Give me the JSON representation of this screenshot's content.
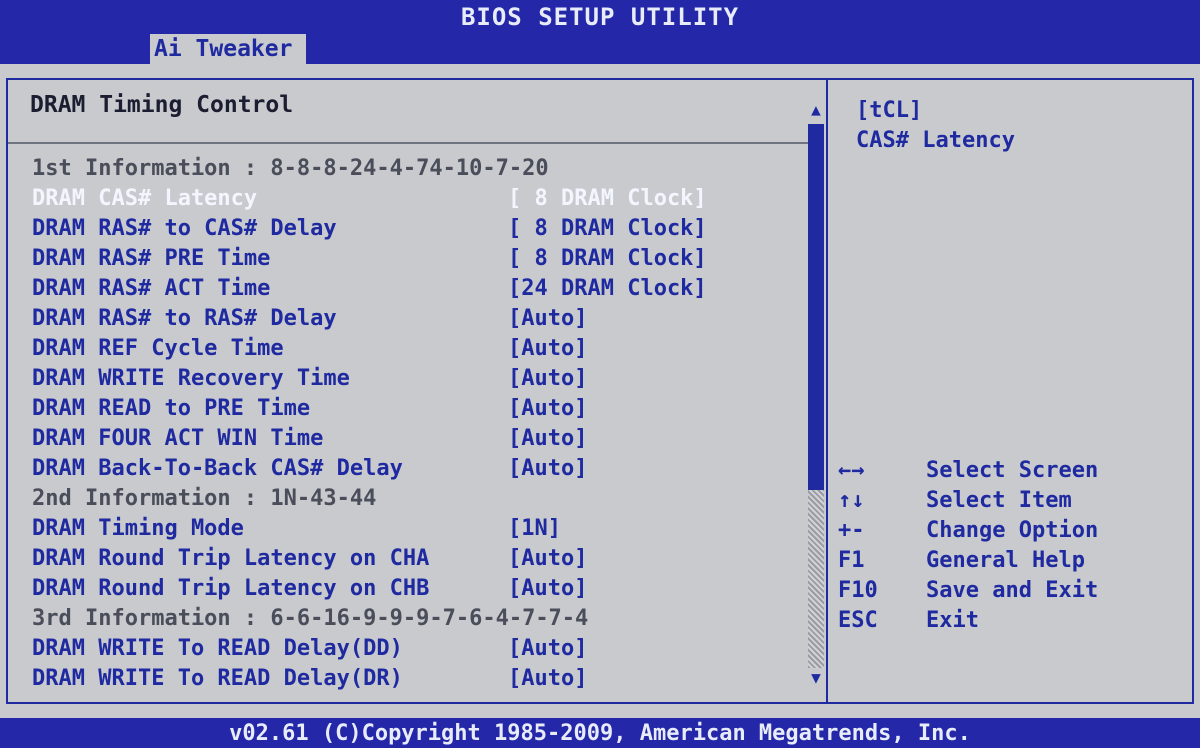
{
  "window": {
    "title": "BIOS SETUP UTILITY"
  },
  "tabs": [
    {
      "label": "Ai Tweaker",
      "active": true
    }
  ],
  "section": {
    "title": "DRAM Timing Control"
  },
  "items": [
    {
      "label": "1st Information : 8-8-8-24-4-74-10-7-20",
      "value": "",
      "type": "info"
    },
    {
      "label": "DRAM CAS# Latency",
      "value": "[ 8 DRAM Clock]",
      "type": "selected"
    },
    {
      "label": "DRAM RAS# to CAS# Delay",
      "value": "[ 8 DRAM Clock]",
      "type": "option"
    },
    {
      "label": "DRAM RAS# PRE Time",
      "value": "[ 8 DRAM Clock]",
      "type": "option"
    },
    {
      "label": "DRAM RAS# ACT Time",
      "value": "[24 DRAM Clock]",
      "type": "option"
    },
    {
      "label": "DRAM RAS# to RAS# Delay",
      "value": "[Auto]",
      "type": "option"
    },
    {
      "label": "DRAM REF Cycle Time",
      "value": "[Auto]",
      "type": "option"
    },
    {
      "label": "DRAM WRITE Recovery Time",
      "value": "[Auto]",
      "type": "option"
    },
    {
      "label": "DRAM READ to PRE Time",
      "value": "[Auto]",
      "type": "option"
    },
    {
      "label": "DRAM FOUR ACT WIN Time",
      "value": "[Auto]",
      "type": "option"
    },
    {
      "label": "DRAM Back-To-Back CAS# Delay",
      "value": "[Auto]",
      "type": "option"
    },
    {
      "label": "2nd Information : 1N-43-44",
      "value": "",
      "type": "info"
    },
    {
      "label": "DRAM Timing Mode",
      "value": "[1N]",
      "type": "option"
    },
    {
      "label": "DRAM Round Trip Latency on CHA",
      "value": "[Auto]",
      "type": "option"
    },
    {
      "label": "DRAM Round Trip Latency on CHB",
      "value": "[Auto]",
      "type": "option"
    },
    {
      "label": "3rd Information : 6-6-16-9-9-9-7-6-4-7-7-4",
      "value": "",
      "type": "info"
    },
    {
      "label": "DRAM WRITE To READ Delay(DD)",
      "value": "[Auto]",
      "type": "option"
    },
    {
      "label": "DRAM WRITE To READ Delay(DR)",
      "value": "[Auto]",
      "type": "option"
    }
  ],
  "scrollbar": {
    "up_arrow": "▲",
    "down_arrow": "▼",
    "position": 0.0,
    "visible_fraction": 0.67
  },
  "help": {
    "title": "[tCL]",
    "description": "CAS# Latency"
  },
  "keys": [
    {
      "key": "←→",
      "desc": "Select Screen"
    },
    {
      "key": "↑↓",
      "desc": "Select Item"
    },
    {
      "key": "+-",
      "desc": "Change Option"
    },
    {
      "key": "F1",
      "desc": "General Help"
    },
    {
      "key": "F10",
      "desc": "Save and Exit"
    },
    {
      "key": "ESC",
      "desc": "Exit"
    }
  ],
  "footer": {
    "text": "v02.61 (C)Copyright 1985-2009, American Megatrends, Inc."
  },
  "colors": {
    "background": "#c8cace",
    "accent_blue": "#2428a8",
    "text_blue": "#1f2aa0",
    "selected_text": "#f4f6ff",
    "info_text": "#4a4e5a"
  }
}
